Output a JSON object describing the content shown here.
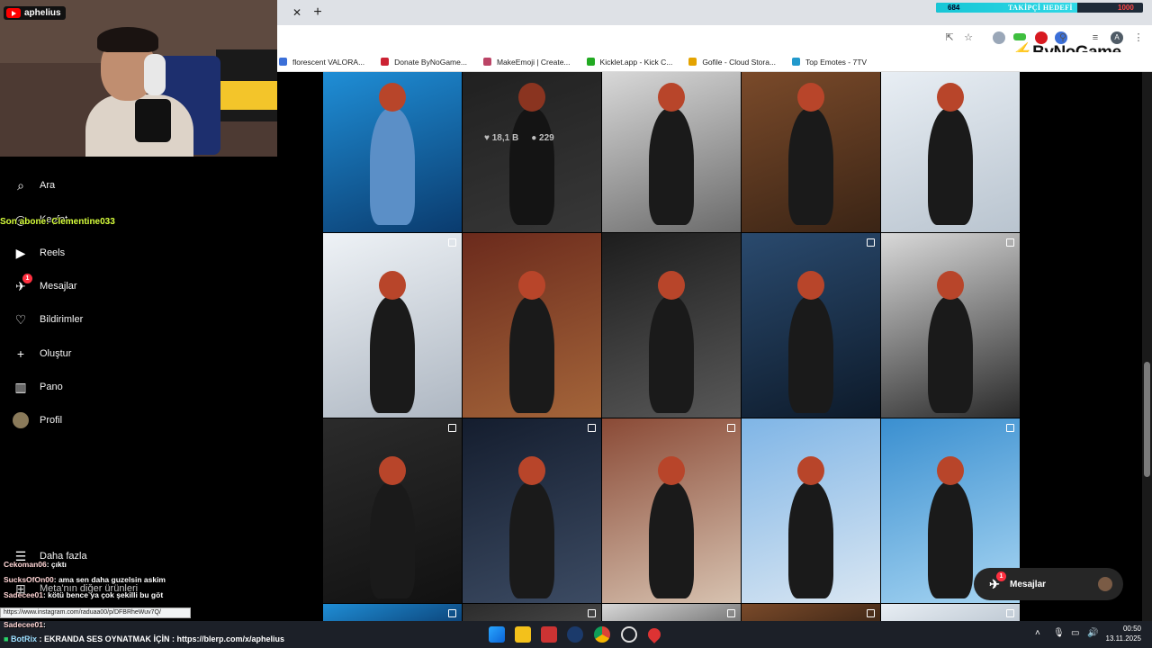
{
  "stream": {
    "channel_name": "aphelius",
    "last_subscriber": "Son abone: Clementine033",
    "goal": {
      "count": "684",
      "label": "TAKİPÇİ HEDEFİ",
      "target": "1000",
      "progress": 0.684
    },
    "bynogame_logo": "ByNoGame",
    "chat": [
      {
        "user": "Cekoman06",
        "text": ": çıktı"
      },
      {
        "user": "SucksOfOn00",
        "text": ": ama sen daha guzelsin askim"
      },
      {
        "user": "Sadecee01",
        "text": ": kötü bence ya çok şekilli bu göt"
      },
      {
        "user": "Sadecee01",
        "text": ":"
      }
    ],
    "botrix": {
      "user": "BotRix",
      "text": ": EKRANDA SES OYNATMAK İÇİN : https://blerp.com/x/aphelius"
    }
  },
  "browser": {
    "bookmarks": [
      {
        "label": "florescent VALORA...",
        "color": "#3b6fd8"
      },
      {
        "label": "Donate ByNoGame...",
        "color": "#c23"
      },
      {
        "label": "MakeEmoji | Create...",
        "color": "#b46"
      },
      {
        "label": "Kicklet.app - Kick C...",
        "color": "#2a2"
      },
      {
        "label": "Gofile - Cloud Stora...",
        "color": "#e4a300"
      },
      {
        "label": "Top Emotes - 7TV",
        "color": "#29c"
      }
    ],
    "status_url": "https://www.instagram.com/raduaa00/p/DFBRheWuv7Q/"
  },
  "instagram": {
    "nav": [
      {
        "label": "Ara",
        "icon": "search-icon"
      },
      {
        "label": "Keşfet",
        "icon": "compass-icon"
      },
      {
        "label": "Reels",
        "icon": "reels-icon"
      },
      {
        "label": "Mesajlar",
        "icon": "messenger-icon",
        "badge": "1"
      },
      {
        "label": "Bildirimler",
        "icon": "heart-icon"
      },
      {
        "label": "Oluştur",
        "icon": "plus-icon"
      },
      {
        "label": "Pano",
        "icon": "dashboard-icon"
      },
      {
        "label": "Profil",
        "icon": "avatar"
      }
    ],
    "more_label": "Daha fazla",
    "meta_label": "Meta'nın diğer ürünleri",
    "hover_likes": "18,1 B",
    "hover_comments": "229",
    "messages_pill": {
      "label": "Mesajlar",
      "badge": "1"
    }
  },
  "taskbar": {
    "time": "00:50",
    "date": "13.11.2025"
  }
}
